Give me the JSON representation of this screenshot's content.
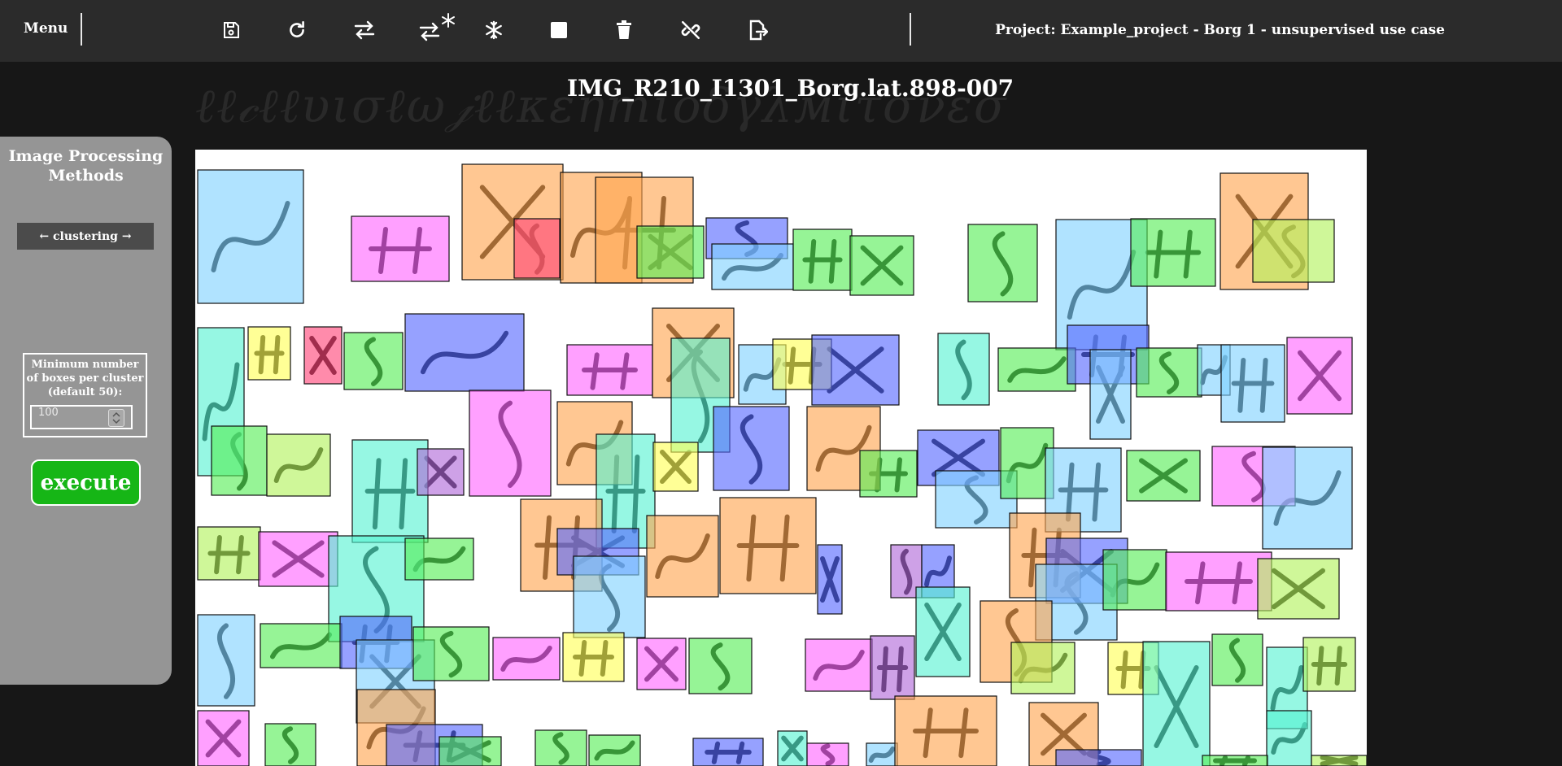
{
  "topbar": {
    "menu_label": "Menu",
    "tools": [
      {
        "name": "save-icon"
      },
      {
        "name": "redo-icon"
      },
      {
        "name": "swap-icon"
      },
      {
        "name": "swap-freeze-icon"
      },
      {
        "name": "snowflake-icon"
      },
      {
        "name": "stop-square-icon"
      },
      {
        "name": "trash-icon"
      },
      {
        "name": "unlink-icon"
      },
      {
        "name": "export-icon"
      }
    ],
    "project_title": "Project: Example_project - Borg 1 - unsupervised use case"
  },
  "image_title": "IMG_R210_I1301_Borg.lat.898-007",
  "sidepanel": {
    "title": "Image Processing Methods",
    "method_nav": "← clustering →",
    "param_label": "Minimum number of boxes per cluster (default 50):",
    "param_value": "100",
    "execute_label": "execute"
  },
  "cluster_colors": {
    "blue": "#7fd2ff",
    "pink": "#ff66ff",
    "orange": "#ffa54f",
    "red": "#ff4477",
    "green": "#55ee55",
    "lime": "#b2f25a",
    "yellow": "#ffff55",
    "indigo": "#5567ff",
    "teal": "#55f2d2",
    "purple": "#b067d9"
  }
}
